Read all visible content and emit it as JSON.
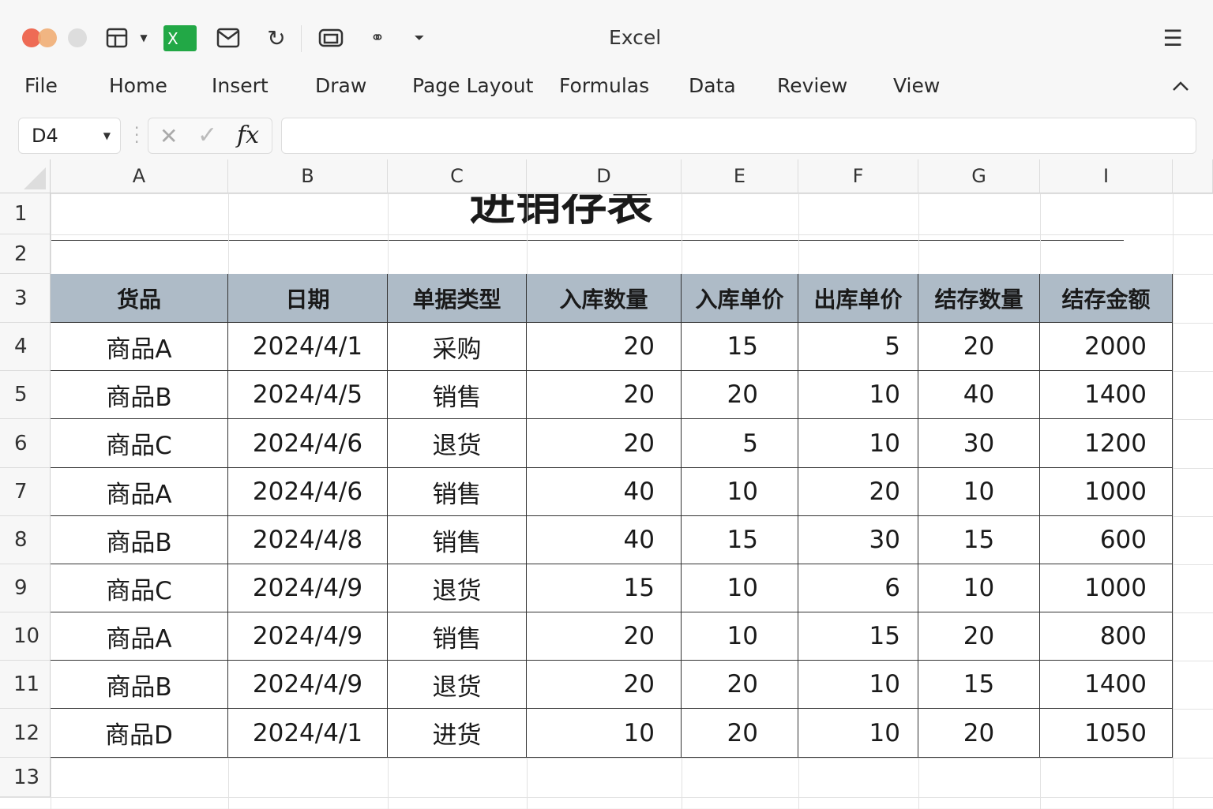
{
  "window": {
    "title": "Excel"
  },
  "toolbar": {
    "icons": [
      "close-dot",
      "minimize-dot",
      "zoom-dot",
      "layout-icon",
      "dropdown-icon",
      "excel-logo-icon",
      "mail-icon",
      "redo-icon",
      "window-icon",
      "shapes-icon",
      "filter-icon",
      "hamburger-menu-icon"
    ],
    "excel_logo_letter": "X"
  },
  "menu": {
    "items": [
      "File",
      "Home",
      "Insert",
      "Draw",
      "Page Layout",
      "Formulas",
      "Data",
      "Review",
      "View"
    ]
  },
  "formula_bar": {
    "name_box": "D4",
    "fx_label": "fx",
    "value": ""
  },
  "columns": [
    "A",
    "B",
    "C",
    "D",
    "E",
    "F",
    "G",
    "I"
  ],
  "rows": [
    "1",
    "2",
    "3",
    "4",
    "5",
    "6",
    "7",
    "8",
    "9",
    "10",
    "11",
    "12",
    "13"
  ],
  "sheet": {
    "title": "进销存表",
    "headers": [
      "货品",
      "日期",
      "单据类型",
      "入库数量",
      "入库单价",
      "出库单价",
      "结存数量",
      "结存金额"
    ],
    "data": [
      [
        "商品A",
        "2024/4/1",
        "采购",
        "20",
        "15",
        "5",
        "20",
        "2000"
      ],
      [
        "商品B",
        "2024/4/5",
        "销售",
        "20",
        "20",
        "10",
        "40",
        "1400"
      ],
      [
        "商品C",
        "2024/4/6",
        "退货",
        "20",
        "5",
        "10",
        "30",
        "1200"
      ],
      [
        "商品A",
        "2024/4/6",
        "销售",
        "40",
        "10",
        "20",
        "10",
        "1000"
      ],
      [
        "商品B",
        "2024/4/8",
        "销售",
        "40",
        "15",
        "30",
        "15",
        "600"
      ],
      [
        "商品C",
        "2024/4/9",
        "退货",
        "15",
        "10",
        "6",
        "10",
        "1000"
      ],
      [
        "商品A",
        "2024/4/9",
        "销售",
        "20",
        "10",
        "15",
        "20",
        "800"
      ],
      [
        "商品B",
        "2024/4/9",
        "退货",
        "20",
        "20",
        "10",
        "15",
        "1400"
      ],
      [
        "商品D",
        "2024/4/1",
        "进货",
        "10",
        "20",
        "10",
        "20",
        "1050"
      ]
    ]
  },
  "colors": {
    "header_fill": "#aebbc7",
    "excel_green": "#22a846",
    "close": "#ee6b55",
    "minimize": "#f0ad74"
  }
}
